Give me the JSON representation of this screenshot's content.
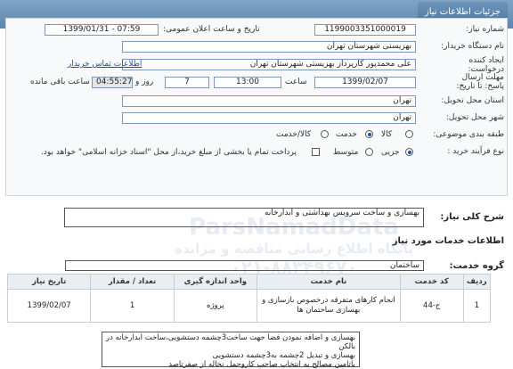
{
  "header": {
    "title": "جزئیات اطلاعات نیاز"
  },
  "form": {
    "need_number_label": "شماره نیاز:",
    "need_number": "1199003351000019",
    "announce_label": "تاریخ و ساعت اعلان عمومی:",
    "announce_value": "1399/01/31 - 07:59",
    "buyer_org_label": "نام دستگاه خریدار:",
    "buyer_org": "بهزیستی شهرستان تهران",
    "creator_label": "ایجاد کننده درخواست:",
    "creator": "علی  محمدپور کارپرداز  بهزیستی شهرستان تهران",
    "contact_link": "اطلاعات تماس خریدار",
    "deadline_label": "مهلت ارسال پاسخ: تا تاریخ:",
    "deadline_date": "1399/02/07",
    "hour_label": "ساعت",
    "deadline_time": "13:00",
    "days_value": "7",
    "days_label": "روز و",
    "remaining_time": "04:55:27",
    "remaining_label": "ساعت باقی مانده",
    "province_label": "استان محل تحویل:",
    "province": "تهران",
    "city_label": "شهر محل تحویل:",
    "city": "تهران",
    "category_label": "طبقه بندی موضوعی:",
    "category_options": [
      "کالا",
      "خدمت",
      "کالا/خدمت"
    ],
    "category_selected": "خدمت",
    "process_label": "نوع فرآیند خرید :",
    "process_options": [
      "جزیی",
      "متوسط"
    ],
    "process_selected": "جزیی",
    "payment_text": "پرداخت تمام یا بخشی از مبلغ خرید،از محل \"اسناد خزانه اسلامی\" خواهد بود."
  },
  "summary": {
    "label": "شرح کلی نیاز:",
    "value": "بهسازی و ساخت سرویس بهداشتی و ابدارخانه"
  },
  "services": {
    "section_title": "اطلاعات خدمات مورد نیاز",
    "group_label": "گروه خدمت:",
    "group_value": "ساختمان",
    "columns": [
      "ردیف",
      "کد خدمت",
      "نام خدمت",
      "واحد اندازه گیری",
      "تعداد / مقدار",
      "تاریخ نیاز"
    ],
    "rows": [
      {
        "index": "1",
        "code": "ج-44",
        "name": "انجام کارهای متفرقه درخصوص بازسازی و بهسازی ساختمان ها",
        "unit": "پروژه",
        "qty": "1",
        "date": "1399/02/07"
      }
    ]
  },
  "buyer_description": {
    "lines": [
      "بهسازی و اضافه نمودن فضا جهت ساخت3چشمه دستشویی،ساخت ابدارخانه در بالکن",
      "بهسازی و تبدیل 2چشمه به3چشمه دستشویی",
      "باتامین مصالح به انتخاب صاحب کاروحمل نخاله از صفرتاصد"
    ]
  },
  "watermark": {
    "line1": "ParsNamadData",
    "line2": "پایگاه اطلاع رسانی مناقصه و مزایده",
    "line3": "۰۲۱-۸۸۳۴۹۶۷۰"
  }
}
